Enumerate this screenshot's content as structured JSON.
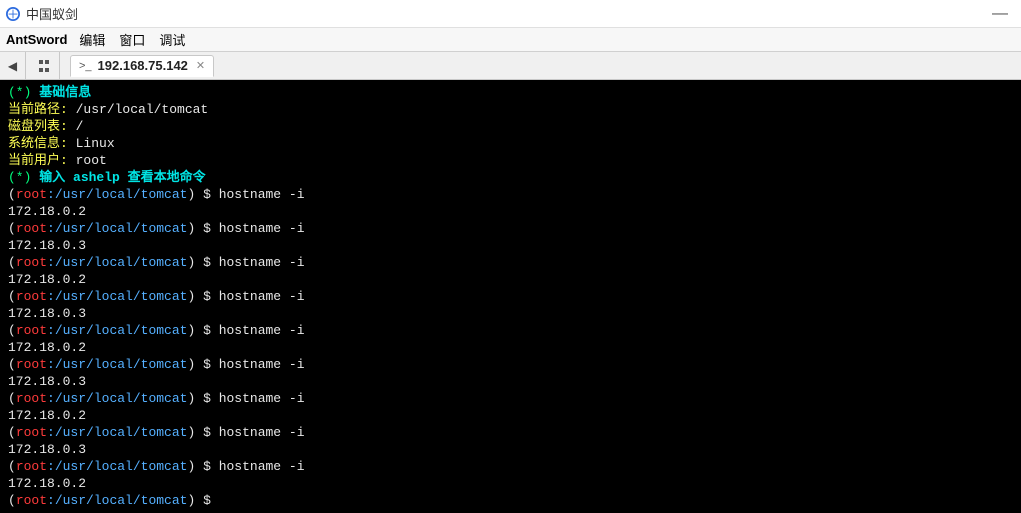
{
  "window": {
    "title": "中国蚁剑"
  },
  "menubar": {
    "brand": "AntSword",
    "items": [
      "编辑",
      "窗口",
      "调试"
    ]
  },
  "tabs": {
    "back": "◀",
    "active": {
      "icon": ">_",
      "label": "192.168.75.142",
      "close": "✕"
    }
  },
  "info": {
    "star": "(*)",
    "header": "基础信息",
    "path_label": "当前路径:",
    "path_value": "/usr/local/tomcat",
    "disk_label": "磁盘列表:",
    "disk_value": "/",
    "sys_label": "系统信息:",
    "sys_value": "Linux",
    "user_label": "当前用户:",
    "user_value": "root",
    "help": "输入 ashelp 查看本地命令"
  },
  "prompt": {
    "user": "root",
    "host_path": ":/usr/local/tomcat",
    "symbol": "$"
  },
  "cmd": "hostname -i",
  "outputs": [
    "172.18.0.2",
    "172.18.0.3",
    "172.18.0.2",
    "172.18.0.3",
    "172.18.0.2",
    "172.18.0.3",
    "172.18.0.2",
    "172.18.0.3",
    "172.18.0.2"
  ]
}
